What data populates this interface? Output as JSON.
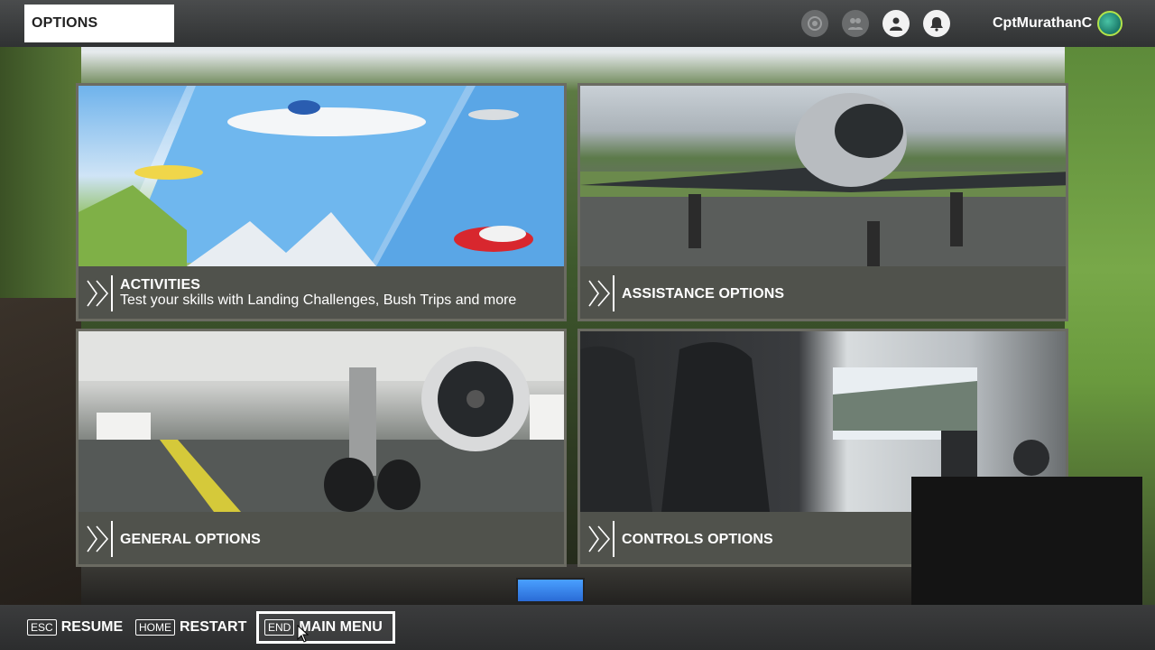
{
  "header": {
    "title": "OPTIONS",
    "username": "CptMurathanC",
    "icons": [
      "achievements-icon",
      "friends-icon",
      "profile-icon",
      "notifications-icon",
      "globe-avatar-icon"
    ]
  },
  "tiles": [
    {
      "title": "ACTIVITIES",
      "subtitle": "Test your skills with Landing Challenges, Bush Trips and more"
    },
    {
      "title": "ASSISTANCE OPTIONS",
      "subtitle": ""
    },
    {
      "title": "GENERAL OPTIONS",
      "subtitle": ""
    },
    {
      "title": "CONTROLS OPTIONS",
      "subtitle": ""
    }
  ],
  "footer": {
    "resume": {
      "key": "ESC",
      "label": "RESUME"
    },
    "restart": {
      "key": "HOME",
      "label": "RESTART"
    },
    "main_menu": {
      "key": "END",
      "label": "MAIN MENU"
    }
  },
  "colors": {
    "topbar": "#303233",
    "caption": "#50524c",
    "accent_globe": "#b2e34a"
  }
}
